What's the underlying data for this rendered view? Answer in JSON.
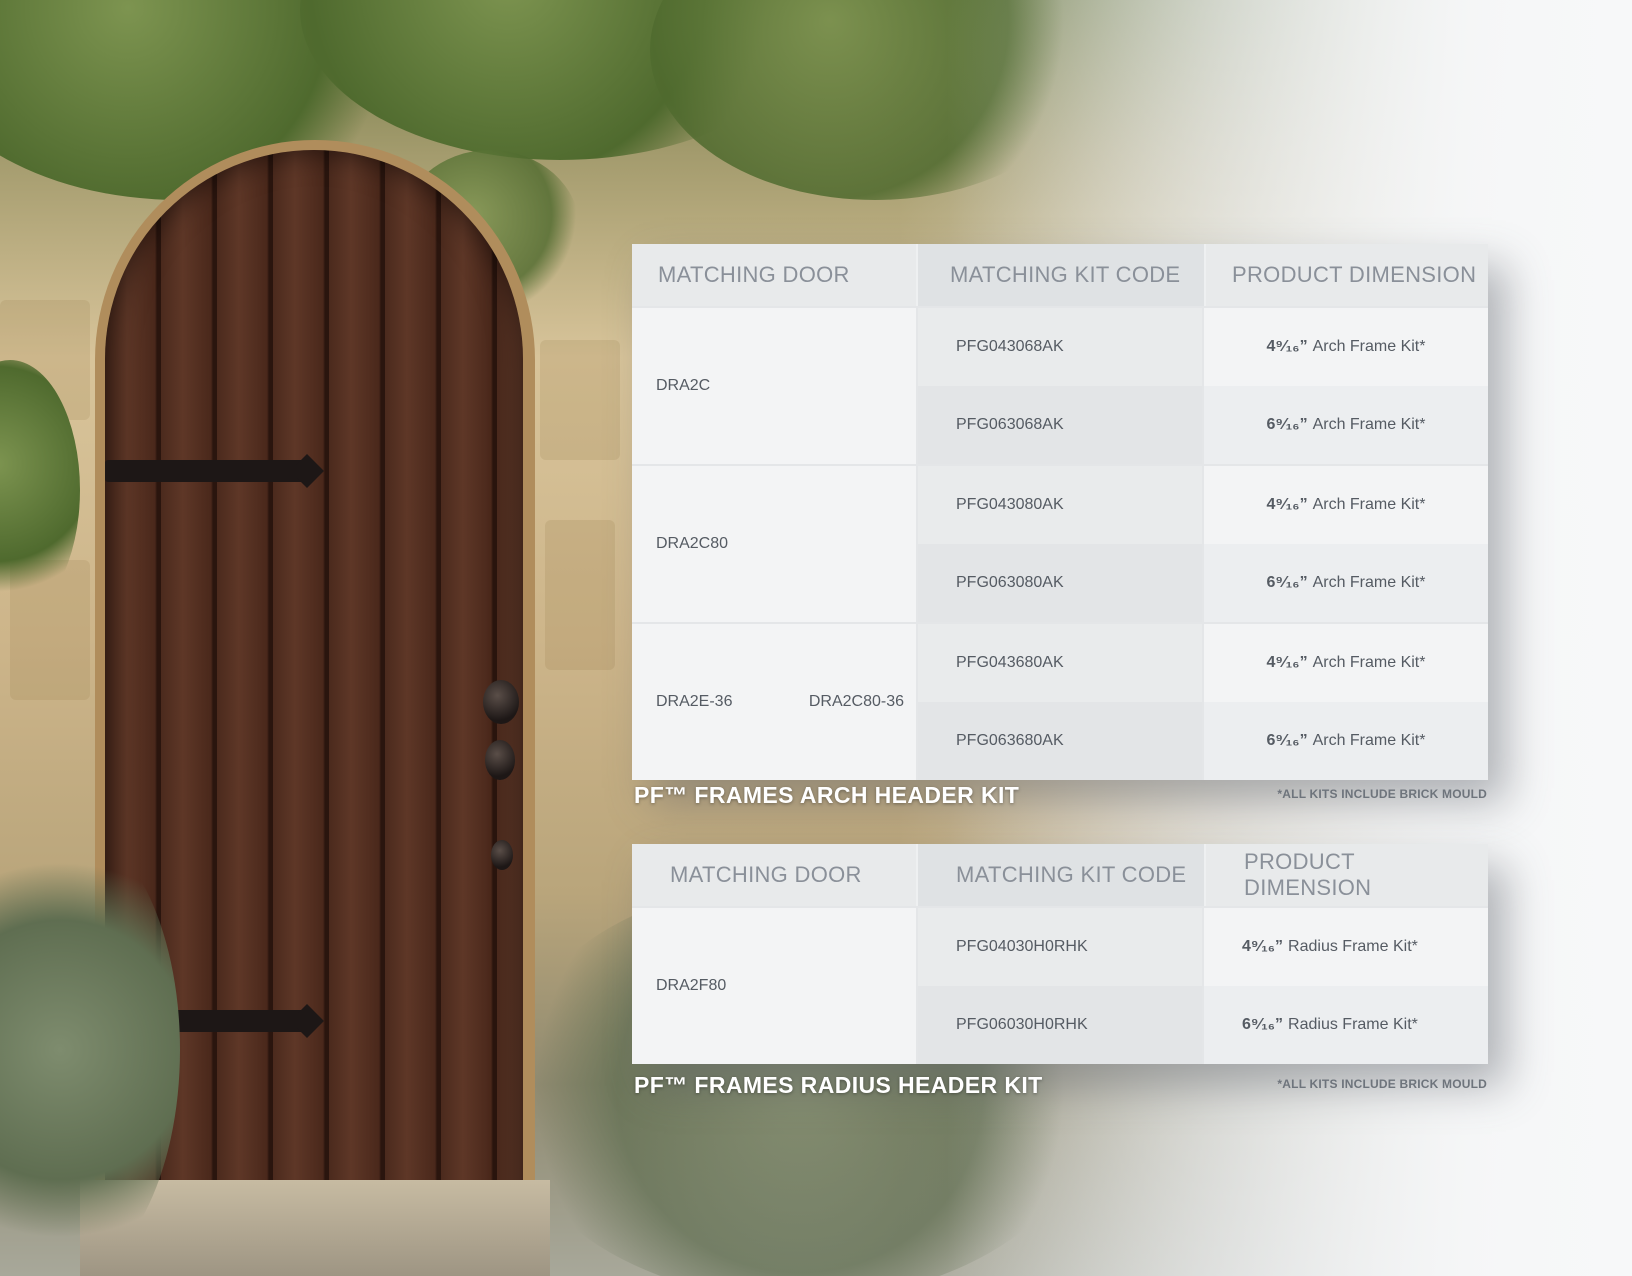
{
  "arch_table": {
    "headers": [
      "MATCHING DOOR",
      "MATCHING KIT CODE",
      "PRODUCT DIMENSION"
    ],
    "groups": [
      {
        "doors": [
          "DRA2C"
        ],
        "rows": [
          {
            "kit_code": "PFG043068AK",
            "dim_fraction": "4⁹⁄₁₆”",
            "dim_text": "Arch Frame Kit*"
          },
          {
            "kit_code": "PFG063068AK",
            "dim_fraction": "6⁹⁄₁₆”",
            "dim_text": "Arch Frame Kit*"
          }
        ]
      },
      {
        "doors": [
          "DRA2C80"
        ],
        "rows": [
          {
            "kit_code": "PFG043080AK",
            "dim_fraction": "4⁹⁄₁₆”",
            "dim_text": "Arch Frame Kit*"
          },
          {
            "kit_code": "PFG063080AK",
            "dim_fraction": "6⁹⁄₁₆”",
            "dim_text": "Arch Frame Kit*"
          }
        ]
      },
      {
        "doors": [
          "DRA2E-36",
          "DRA2C80-36"
        ],
        "rows": [
          {
            "kit_code": "PFG043680AK",
            "dim_fraction": "4⁹⁄₁₆”",
            "dim_text": "Arch Frame Kit*"
          },
          {
            "kit_code": "PFG063680AK",
            "dim_fraction": "6⁹⁄₁₆”",
            "dim_text": "Arch Frame Kit*"
          }
        ]
      }
    ],
    "caption": "PF™ FRAMES ARCH HEADER KIT",
    "note": "*ALL KITS INCLUDE BRICK MOULD"
  },
  "radius_table": {
    "headers": [
      "MATCHING DOOR",
      "MATCHING KIT CODE",
      "PRODUCT DIMENSION"
    ],
    "groups": [
      {
        "doors": [
          "DRA2F80"
        ],
        "rows": [
          {
            "kit_code": "PFG04030H0RHK",
            "dim_fraction": "4⁹⁄₁₆”",
            "dim_text": "Radius Frame Kit*"
          },
          {
            "kit_code": "PFG06030H0RHK",
            "dim_fraction": "6⁹⁄₁₆”",
            "dim_text": "Radius Frame Kit*"
          }
        ]
      }
    ],
    "caption": "PF™ FRAMES RADIUS HEADER KIT",
    "note": "*ALL KITS INCLUDE BRICK MOULD"
  }
}
